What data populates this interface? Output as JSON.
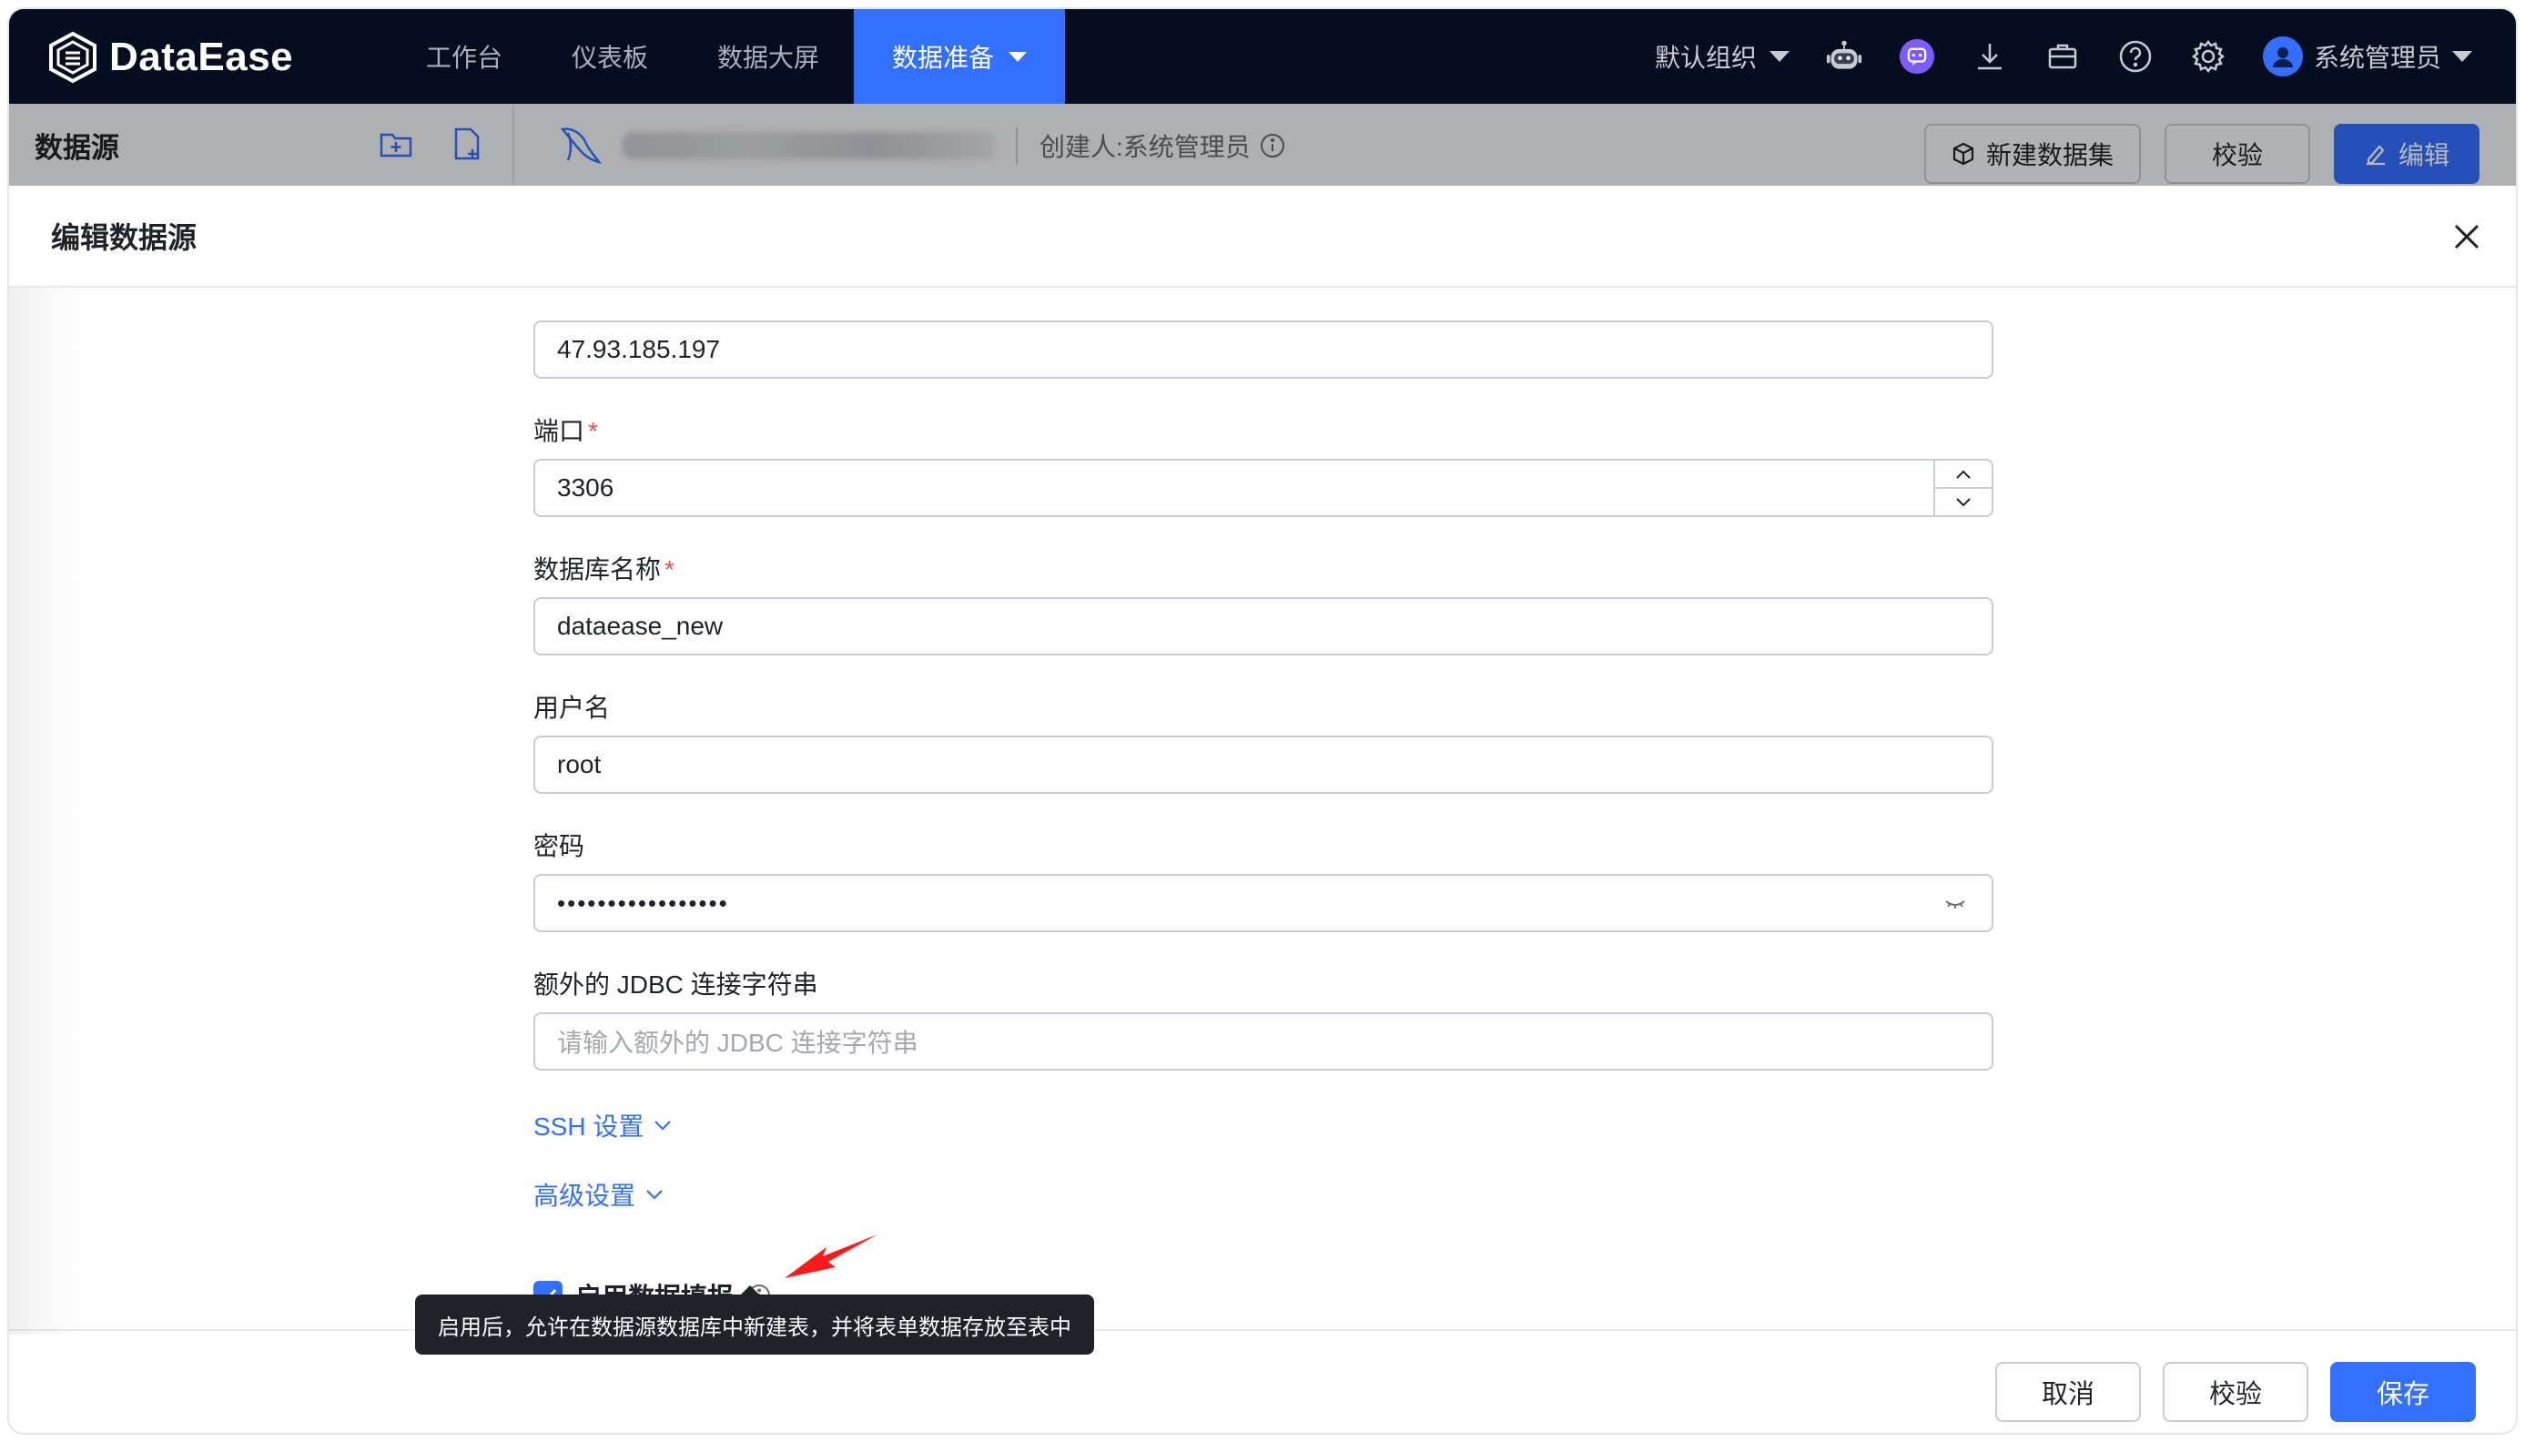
{
  "app": {
    "name": "DataEase"
  },
  "nav": {
    "items": [
      {
        "label": "工作台"
      },
      {
        "label": "仪表板"
      },
      {
        "label": "数据大屏"
      },
      {
        "label": "数据准备",
        "active": true
      }
    ],
    "org_label": "默认组织",
    "user_label": "系统管理员",
    "icons": [
      "ai-robot-icon",
      "chat-icon",
      "download-icon",
      "briefcase-icon",
      "help-icon",
      "gear-icon",
      "user-avatar-icon"
    ]
  },
  "subbar": {
    "title": "数据源",
    "creator": "创建人:系统管理员",
    "buttons": {
      "new_dataset": "新建数据集",
      "validate": "校验",
      "edit": "编辑"
    }
  },
  "drawer": {
    "title": "编辑数据源",
    "host": {
      "value": "47.93.185.197"
    },
    "port": {
      "label": "端口",
      "value": "3306"
    },
    "database": {
      "label": "数据库名称",
      "value": "dataease_new"
    },
    "username": {
      "label": "用户名",
      "value": "root"
    },
    "password": {
      "label": "密码",
      "value": "•••••••••••••••••"
    },
    "jdbc": {
      "label": "额外的 JDBC 连接字符串",
      "placeholder": "请输入额外的 JDBC 连接字符串"
    },
    "ssh_link": "SSH 设置",
    "advanced_link": "高级设置",
    "fill_checkbox": {
      "label": "启用数据填报",
      "checked": true
    },
    "tooltip": "启用后，允许在数据源数据库中新建表，并将表单数据存放至表中",
    "footer": {
      "cancel": "取消",
      "validate": "校验",
      "save": "保存"
    }
  },
  "colors": {
    "primary": "#3370ff",
    "nav_bg": "#050e1e",
    "required": "#f54a45",
    "annotation_arrow": "#ff1a1a"
  }
}
